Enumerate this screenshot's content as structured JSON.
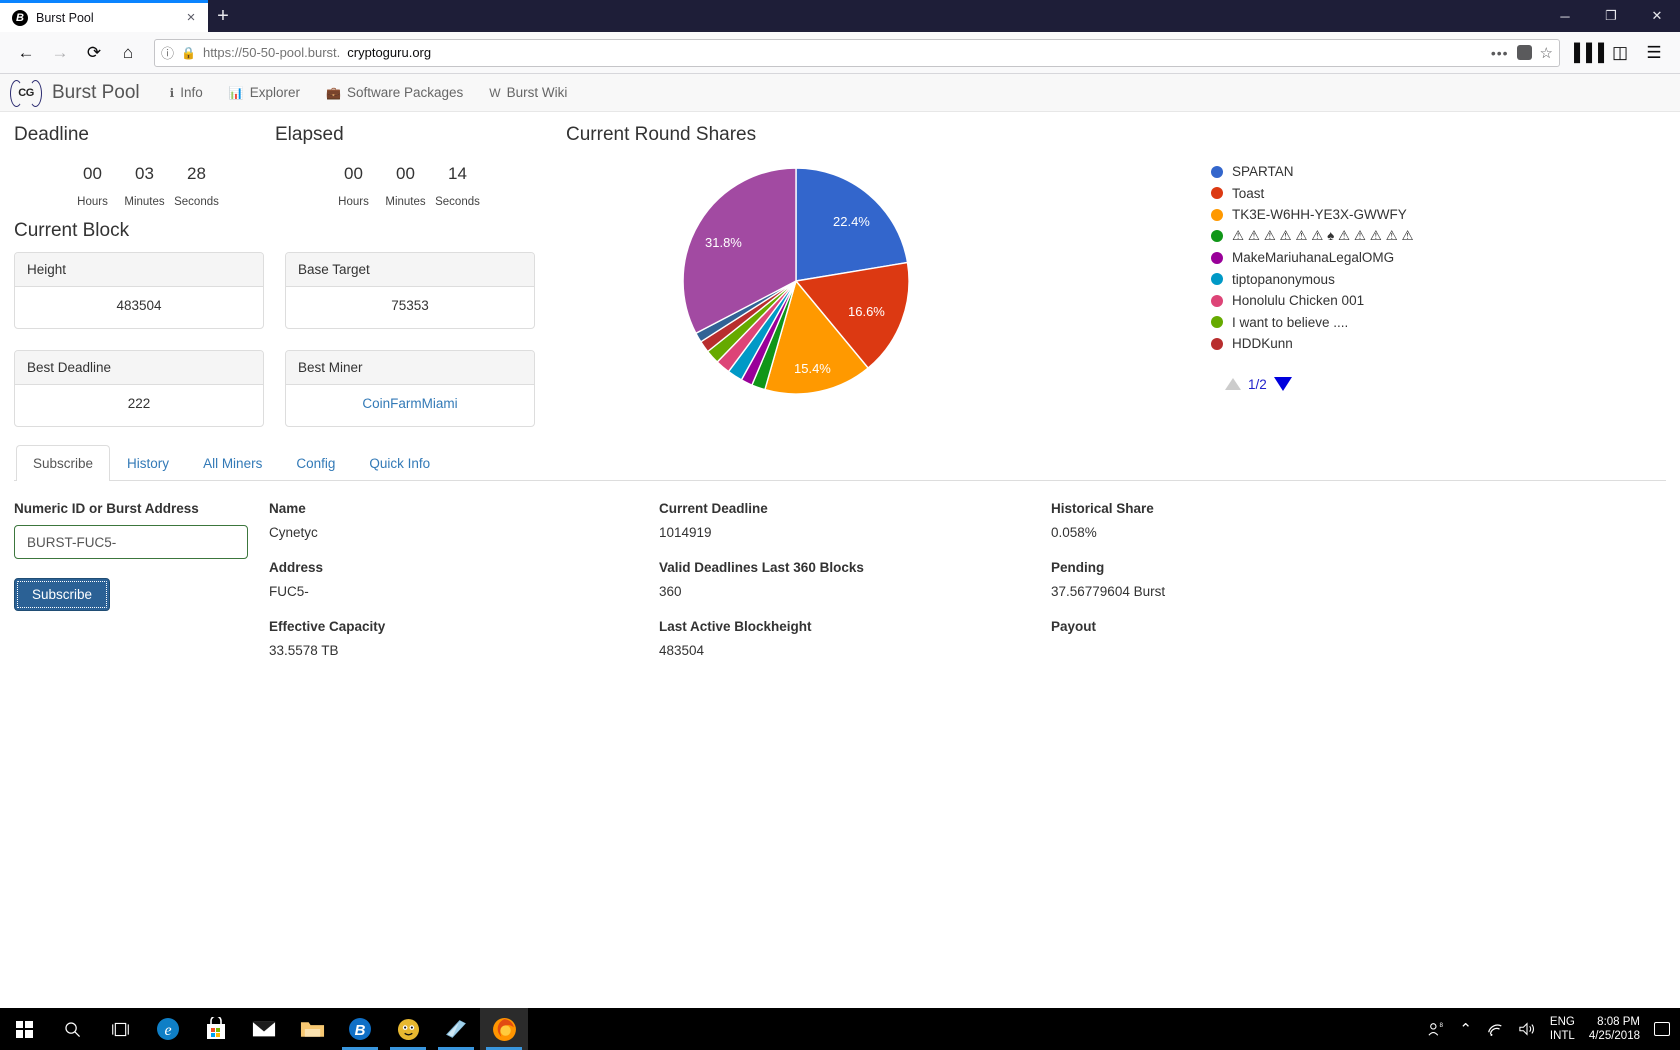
{
  "browser": {
    "tab_title": "Burst Pool",
    "favicon_letter": "B",
    "close_tab_label": "×",
    "new_tab_label": "+",
    "window_minimize": "─",
    "window_maximize": "❐",
    "window_close": "✕",
    "back_icon": "←",
    "forward_icon": "→",
    "reload_icon": "⟳",
    "home_icon": "⌂",
    "info_icon": "ⓘ",
    "lock_icon": "🔒",
    "url_prefix": "https://50-50-pool.burst.",
    "url_domain": "cryptoguru.org",
    "ellipsis": "•••",
    "pocket_icon": "▼",
    "star_icon": "☆",
    "library_icon": "▐▐▐",
    "sidebar_icon": "◫",
    "menu_icon": "☰"
  },
  "site": {
    "logo_text": "CG",
    "brand_name": "Burst Pool",
    "nav": [
      {
        "label": "Info",
        "icon": "ℹ"
      },
      {
        "label": "Explorer",
        "icon": "📊"
      },
      {
        "label": "Software Packages",
        "icon": "💼"
      },
      {
        "label": "Burst Wiki",
        "icon": "W"
      }
    ]
  },
  "timers": {
    "deadline": {
      "title": "Deadline",
      "values": [
        "00",
        "03",
        "28"
      ],
      "labels": [
        "Hours",
        "Minutes",
        "Seconds"
      ]
    },
    "elapsed": {
      "title": "Elapsed",
      "values": [
        "00",
        "00",
        "14"
      ],
      "labels": [
        "Hours",
        "Minutes",
        "Seconds"
      ]
    }
  },
  "current_block": {
    "title": "Current Block",
    "cards": [
      {
        "head": "Height",
        "value": "483504",
        "link": false
      },
      {
        "head": "Base Target",
        "value": "75353",
        "link": false
      },
      {
        "head": "Best Deadline",
        "value": "222",
        "link": false
      },
      {
        "head": "Best Miner",
        "value": "CoinFarmMiami",
        "link": true
      }
    ]
  },
  "shares": {
    "title": "Current Round Shares",
    "pager": {
      "prev": "▲",
      "count": "1/2",
      "next": "▼"
    }
  },
  "chart_data": {
    "type": "pie",
    "title": "Current Round Shares",
    "legend_position": "right",
    "labels": [
      "SPARTAN",
      "Toast",
      "TK3E-W6HH-YE3X-GWWFY",
      "⚠ ⚠ ⚠ ⚠ ⚠ ⚠ ♠ ⚠ ⚠ ⚠ ⚠ ⚠",
      "MakeMariuhanaLegalOMG",
      "tiptopanonymous",
      "Honolulu Chicken 001",
      "I want to believe ....",
      "HDDKunn"
    ],
    "values": [
      22.4,
      16.6,
      15.4,
      2.0,
      31.8,
      2.4,
      2.2,
      2.0,
      1.6
    ],
    "displayed_percent_labels": [
      "22.4%",
      "16.6%",
      "15.4%",
      "31.8%"
    ],
    "colors": [
      "#3366cc",
      "#dc3912",
      "#ff9900",
      "#109618",
      "#990099",
      "#0099c6",
      "#dd4477",
      "#66aa00",
      "#b82e2e",
      "#316395"
    ]
  },
  "tabs": {
    "items": [
      {
        "label": "Subscribe",
        "active": true
      },
      {
        "label": "History",
        "active": false
      },
      {
        "label": "All Miners",
        "active": false
      },
      {
        "label": "Config",
        "active": false
      },
      {
        "label": "Quick Info",
        "active": false
      }
    ]
  },
  "subscribe": {
    "form_label": "Numeric ID or Burst Address",
    "input_value": "BURST-FUC5-",
    "input_placeholder": "Numeric ID or Burst Address",
    "button_label": "Subscribe"
  },
  "details": {
    "col1": [
      {
        "key": "Name",
        "value": "Cynetyc"
      },
      {
        "key": "Address",
        "value": "FUC5-"
      },
      {
        "key": "Effective Capacity",
        "value": "33.5578 TB"
      }
    ],
    "col2": [
      {
        "key": "Current Deadline",
        "value": "1014919"
      },
      {
        "key": "Valid Deadlines Last 360 Blocks",
        "value": "360"
      },
      {
        "key": "Last Active Blockheight",
        "value": "483504"
      }
    ],
    "col3": [
      {
        "key": "Historical Share",
        "value": "0.058%"
      },
      {
        "key": "Pending",
        "value": "37.56779604 Burst"
      },
      {
        "key": "Payout",
        "value": ""
      }
    ]
  },
  "taskbar": {
    "start_label": "Start",
    "search_icon": "⌕",
    "taskview_icon": "⌷",
    "apps": [
      "edge",
      "store",
      "mail",
      "explorer",
      "burst",
      "app-yellow",
      "app-blue",
      "firefox"
    ],
    "tray": {
      "people_icon": "⚲",
      "chevron_icon": "⌃",
      "wifi_icon": "◠",
      "volume_icon": "🔊",
      "lang_line1": "ENG",
      "lang_line2": "INTL",
      "time": "8:08 PM",
      "date": "4/25/2018",
      "notification_icon": "▭"
    }
  }
}
